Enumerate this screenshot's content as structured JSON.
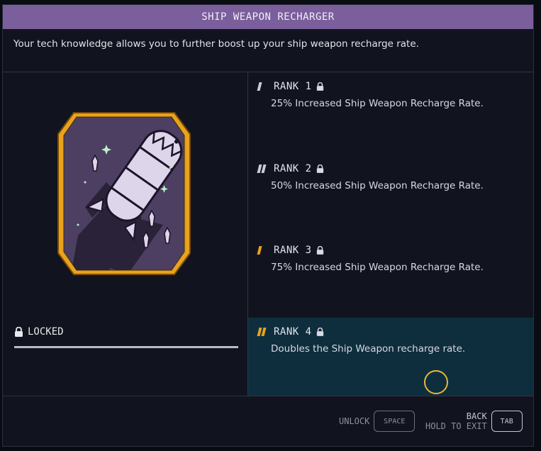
{
  "panel": {
    "title": "SHIP WEAPON RECHARGER",
    "description": "Your tech knowledge allows you to further boost up your ship weapon recharge rate."
  },
  "skill": {
    "badge_icon": "shark-rocket-patch",
    "status": "LOCKED",
    "status_icon": "lock-icon"
  },
  "ranks": [
    {
      "label": "RANK 1",
      "description": "25% Increased Ship Weapon Recharge Rate.",
      "locked": true
    },
    {
      "label": "RANK 2",
      "description": "50% Increased Ship Weapon Recharge Rate.",
      "locked": true
    },
    {
      "label": "RANK 3",
      "description": "75% Increased Ship Weapon Recharge Rate.",
      "locked": true
    },
    {
      "label": "RANK 4",
      "description": "Doubles the Ship Weapon recharge rate.",
      "locked": true,
      "selected": true
    }
  ],
  "footer": {
    "unlock_label": "UNLOCK",
    "unlock_key": "SPACE",
    "back_label": "BACK",
    "exit_label": "HOLD TO EXIT",
    "back_key": "TAB"
  },
  "colors": {
    "title_bar": "#7b5e9c",
    "accent_gold": "#e8a21c",
    "selected_row": "#0e2e3e"
  }
}
